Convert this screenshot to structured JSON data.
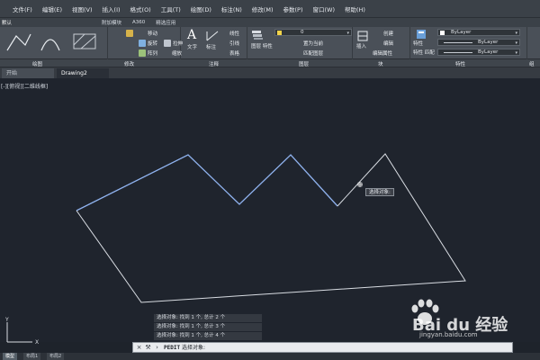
{
  "menu": {
    "items": [
      "文件(F)",
      "编辑(E)",
      "视图(V)",
      "插入(I)",
      "格式(O)",
      "工具(T)",
      "绘图(D)",
      "标注(N)",
      "修改(M)",
      "参数(P)",
      "窗口(W)",
      "帮助(H)"
    ]
  },
  "ribbon_tabs": [
    "默认",
    "附加模块",
    "A360",
    "精选应用"
  ],
  "ribbon": {
    "move": "移动",
    "rotate": "旋转",
    "array": "阵列",
    "stretch": "拉伸",
    "scale": "缩放",
    "text": "文字",
    "dimension": "标注",
    "linear": "线性",
    "leader": "引线",
    "table": "表格",
    "layer_props": "图层\n特性",
    "layer_name": "0",
    "set_current": "置为当前",
    "match_layer": "匹配图层",
    "insert": "插入",
    "create": "创建",
    "edit": "编辑",
    "edit_attributes": "编辑属性",
    "properties": "特性",
    "match_props": "特性\n匹配",
    "bylayer_color": "ByLayer",
    "bylayer_linetype": "ByLayer",
    "bylayer_lineweight": "ByLayer"
  },
  "panel_titles": {
    "draw": "绘图",
    "modify": "修改",
    "annotation": "注释",
    "layers": "图层",
    "block": "块",
    "properties": "特性",
    "groups": "组"
  },
  "doc_tabs": [
    "开始",
    "Drawing2"
  ],
  "viewport_label": "[-][俯视][二维线框]",
  "tooltip": "选择对象:",
  "command_history": [
    "选择对象: 找到 1 个, 总计 2 个",
    "选择对象: 找到 1 个, 总计 3 个",
    "选择对象: 找到 1 个, 总计 4 个"
  ],
  "command_prompt": {
    "command": "PEDIT",
    "text": "选择对象:"
  },
  "layout_tabs": [
    "模型",
    "布局1",
    "布局2"
  ],
  "ucs": {
    "y_label": "Y",
    "x_label": "X"
  },
  "watermark": {
    "brand": "Bai du 经验",
    "url": "jingyan.baidu.com"
  },
  "colors": {
    "selected_polyline": "#8fb2ee",
    "unselected_lines": "#d8dce2",
    "canvas": "#1f242d",
    "ribbon": "#4a5058"
  }
}
